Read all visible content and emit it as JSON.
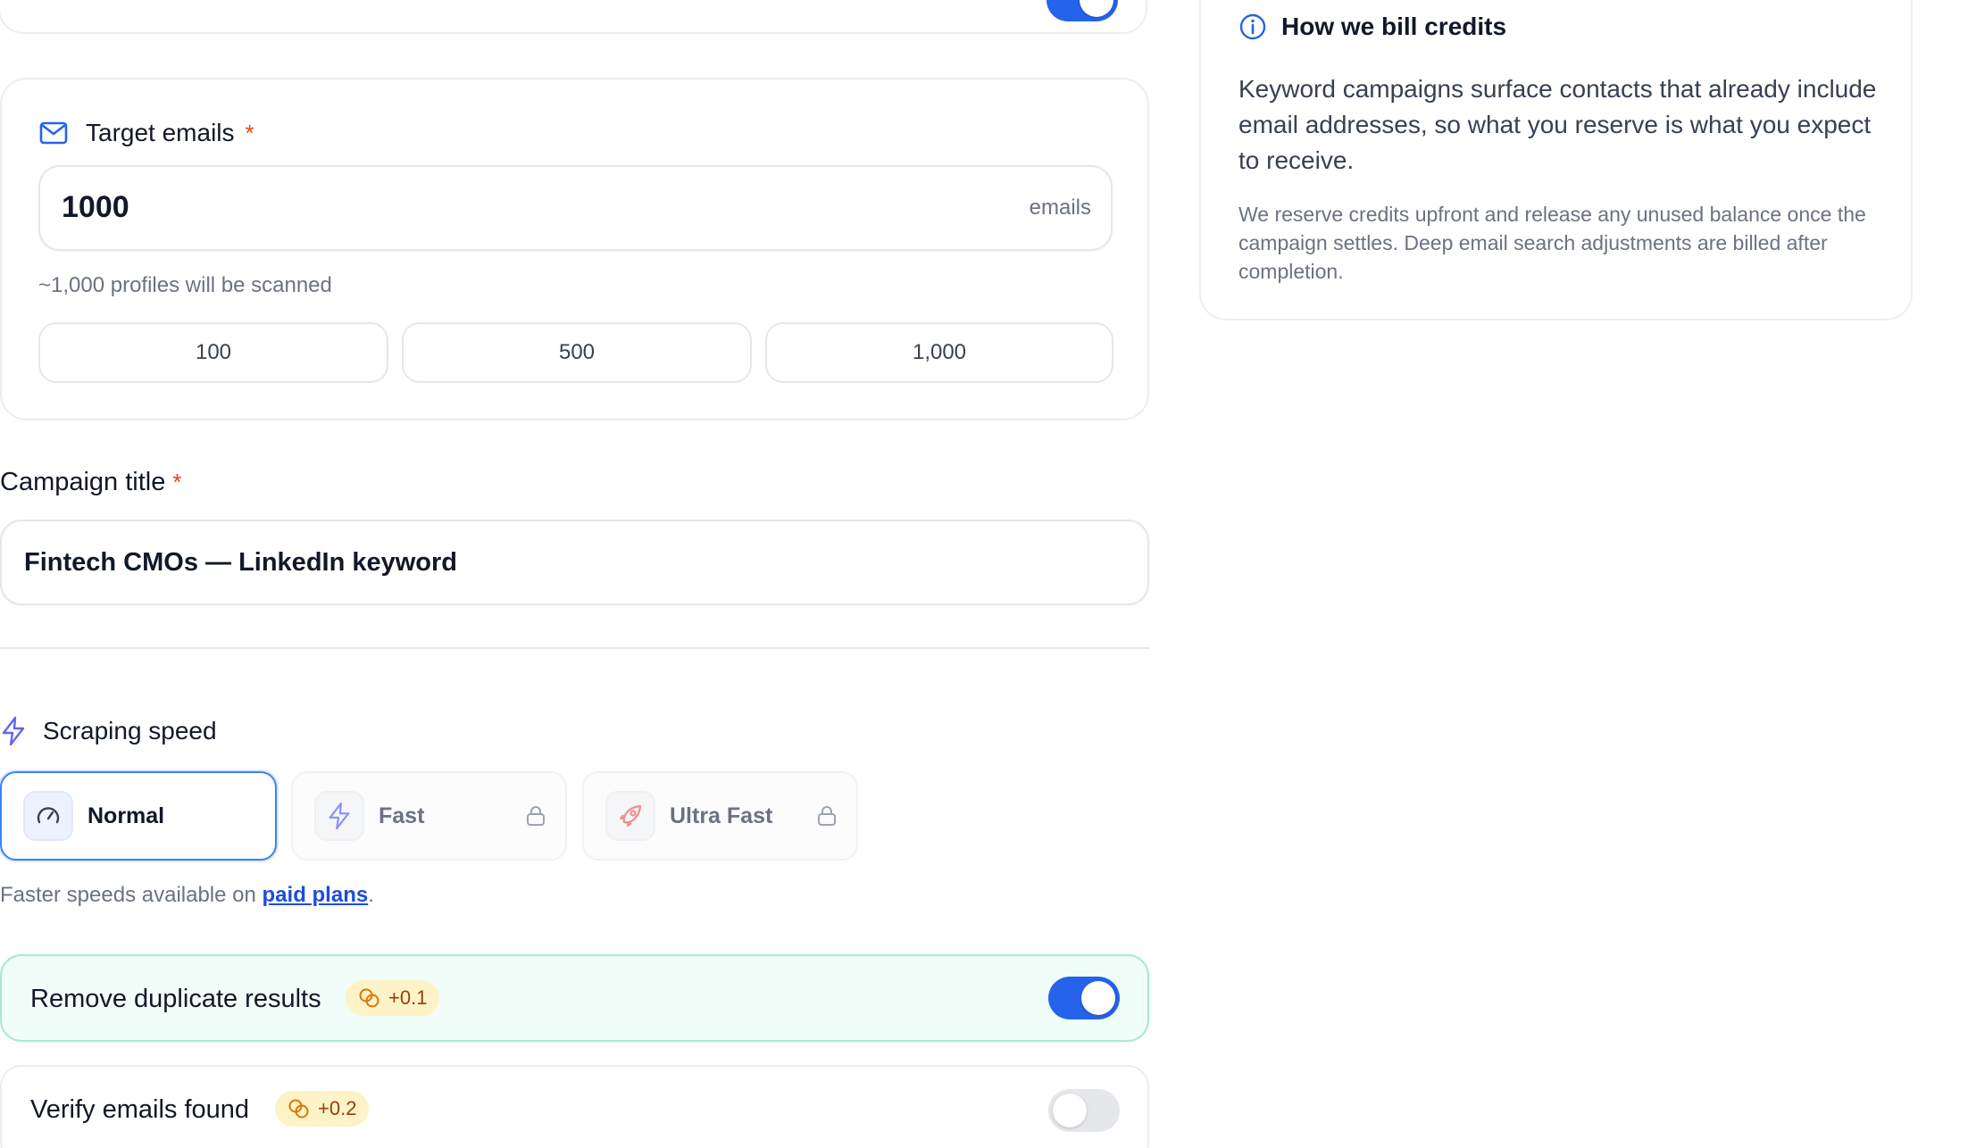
{
  "top_section": {
    "toggle_on": true
  },
  "target_emails": {
    "label": "Target emails",
    "required_mark": "*",
    "value": "1000",
    "suffix": "emails",
    "helper": "~1,000 profiles will be scanned",
    "presets": [
      "100",
      "500",
      "1,000"
    ]
  },
  "campaign_title": {
    "label": "Campaign title",
    "required_mark": "*",
    "value": "Fintech CMOs — LinkedIn keyword"
  },
  "scraping_speed": {
    "label": "Scraping speed",
    "options": [
      {
        "label": "Normal",
        "icon": "gauge-icon",
        "selected": true,
        "locked": false
      },
      {
        "label": "Fast",
        "icon": "lightning-icon",
        "selected": false,
        "locked": true
      },
      {
        "label": "Ultra Fast",
        "icon": "rocket-icon",
        "selected": false,
        "locked": true
      }
    ],
    "note_prefix": "Faster speeds available on ",
    "note_link": "paid plans",
    "note_suffix": "."
  },
  "options": [
    {
      "label": "Remove duplicate results",
      "badge": "+0.1",
      "enabled": true
    },
    {
      "label": "Verify emails found",
      "badge": "+0.2",
      "enabled": false
    }
  ],
  "billing_info": {
    "title": "How we bill credits",
    "paragraph1": "Keyword campaigns surface contacts that already include email addresses, so what you reserve is what you expect to receive.",
    "paragraph2": "We reserve credits upfront and release any unused balance once the campaign settles. Deep email search adjustments are billed after completion."
  },
  "colors": {
    "accent": "#2563eb",
    "required": "#dc4a1a",
    "badge_bg": "#fef3c7",
    "active_row_bg": "#f1fdf8"
  }
}
